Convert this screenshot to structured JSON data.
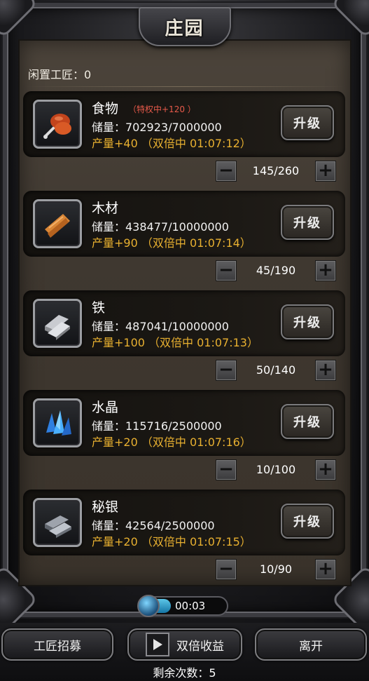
{
  "title": "庄园",
  "idle_workers": "闲置工匠：0",
  "upgrade_label": "升级",
  "resources": [
    {
      "name": "食物",
      "icon": "food-icon",
      "bonus": "（特权中+120 ）",
      "storage": "储量：702923/7000000",
      "production": "产量+40 （双倍中 01:07:12）",
      "workers": "145/260"
    },
    {
      "name": "木材",
      "icon": "wood-icon",
      "bonus": "",
      "storage": "储量：438477/10000000",
      "production": "产量+90 （双倍中 01:07:14）",
      "workers": "45/190"
    },
    {
      "name": "铁",
      "icon": "iron-icon",
      "bonus": "",
      "storage": "储量：487041/10000000",
      "production": "产量+100 （双倍中 01:07:13）",
      "workers": "50/140"
    },
    {
      "name": "水晶",
      "icon": "crystal-icon",
      "bonus": "",
      "storage": "储量：115716/2500000",
      "production": "产量+20 （双倍中 01:07:16）",
      "workers": "10/100"
    },
    {
      "name": "秘银",
      "icon": "mithril-icon",
      "bonus": "",
      "storage": "储量：42564/2500000",
      "production": "产量+20 （双倍中 01:07:15）",
      "workers": "10/90"
    }
  ],
  "stepper": {
    "minus": "−",
    "plus": "+"
  },
  "timer": {
    "text": "00:03",
    "progress": 0.35
  },
  "bottom": {
    "recruit_label": "工匠招募",
    "double_label": "双倍收益",
    "leave_label": "离开",
    "remaining": "剩余次数：5"
  },
  "colors": {
    "production": "#e8b030",
    "bonus": "#e85a4a",
    "panel": "#3f3830"
  }
}
